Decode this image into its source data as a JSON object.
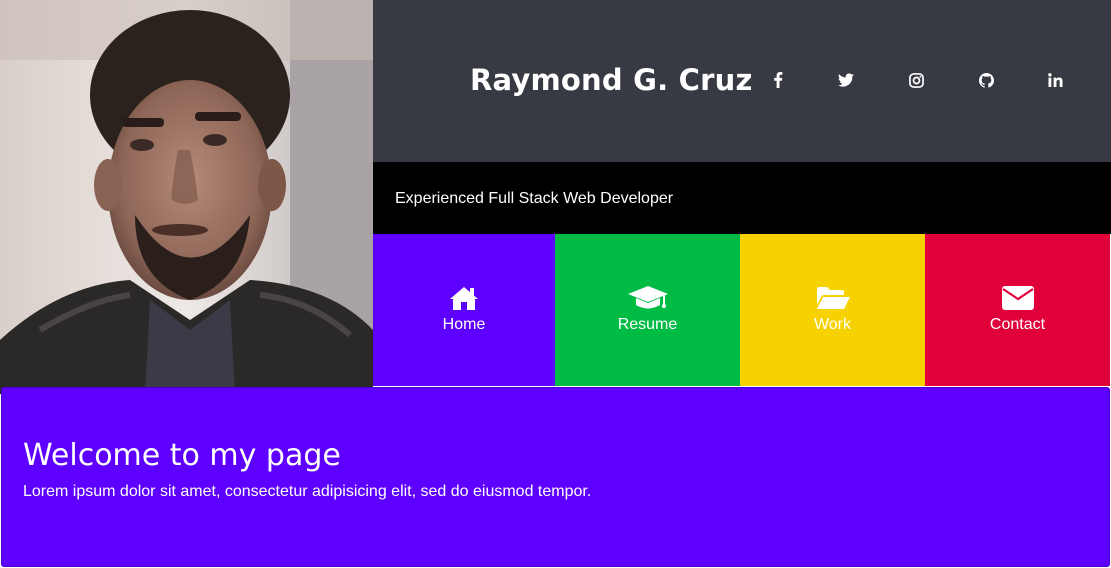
{
  "profile": {
    "photo_alt": "profile photo"
  },
  "header": {
    "name": "Raymond G. Cruz",
    "social": [
      {
        "icon": "facebook-icon"
      },
      {
        "icon": "twitter-icon"
      },
      {
        "icon": "instagram-icon"
      },
      {
        "icon": "github-icon"
      },
      {
        "icon": "linkedin-icon"
      }
    ]
  },
  "tagline": "Experienced Full Stack Web Developer",
  "nav": [
    {
      "label": "Home",
      "icon": "home-icon",
      "color": "#5d00ff"
    },
    {
      "label": "Resume",
      "icon": "graduation-cap-icon",
      "color": "#00bb44"
    },
    {
      "label": "Work",
      "icon": "folder-open-icon",
      "color": "#f6d200"
    },
    {
      "label": "Contact",
      "icon": "envelope-icon",
      "color": "#e0003a"
    }
  ],
  "welcome": {
    "title": "Welcome to my page",
    "text": "Lorem ipsum dolor sit amet, consectetur adipisicing elit, sed do eiusmod tempor."
  },
  "colors": {
    "header_bg": "#383a43",
    "tagline_bg": "#000000",
    "welcome_bg": "#5d00ff"
  }
}
